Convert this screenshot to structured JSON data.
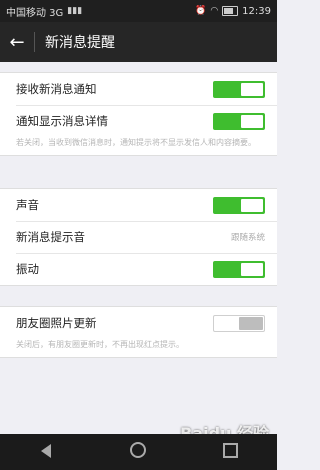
{
  "status_bar": {
    "carrier": "中国移动 3G",
    "time": "12:39"
  },
  "nav": {
    "title": "新消息提醒"
  },
  "group1": {
    "row1_label": "接收新消息通知",
    "row1_on": true,
    "row2_label": "通知显示消息详情",
    "row2_on": true,
    "note": "若关闭，当收到微信消息时，通知提示将不显示发信人和内容摘要。"
  },
  "group2": {
    "sound_label": "声音",
    "sound_on": true,
    "ringtone_label": "新消息提示音",
    "ringtone_value": "跟随系统",
    "vibrate_label": "振动",
    "vibrate_on": true
  },
  "group3": {
    "moments_label": "朋友圈照片更新",
    "moments_on": false,
    "note": "关闭后，有朋友圈更新时，不再出现红点提示。"
  },
  "watermark": "Baidu 经验"
}
